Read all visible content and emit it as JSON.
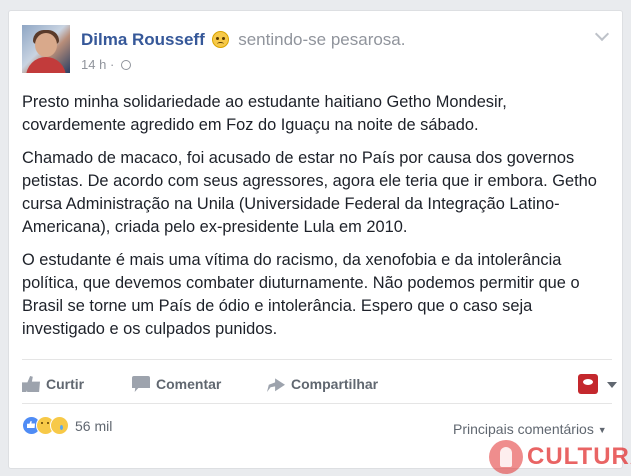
{
  "header": {
    "author": "Dilma Rousseff",
    "feeling": "sentindo-se pesarosa.",
    "timestamp": "14 h",
    "separator": "·"
  },
  "post": {
    "paragraphs": [
      "Presto minha solidariedade ao estudante haitiano Getho Mondesir, covardemente agredido em Foz do Iguaçu na noite de sábado.",
      "Chamado de macaco, foi acusado de estar no País por causa dos governos petistas. De acordo com seus agressores, agora ele teria que ir embora. Getho cursa Administração na Unila (Universidade Federal da Integração Latino-Americana), criada pelo ex-presidente Lula em 2010.",
      "O estudante é mais uma vítima do racismo, da xenofobia e da intolerância política, que devemos combater diuturnamente. Não podemos permitir que o Brasil se torne um País de ódio e intolerância. Espero que o caso seja investigado e os culpados punidos."
    ]
  },
  "actions": {
    "like": "Curtir",
    "comment": "Comentar",
    "share": "Compartilhar"
  },
  "footer": {
    "reaction_count": "56 mil",
    "sort_label": "Principais comentários",
    "sort_caret": "▼"
  },
  "watermark": {
    "text": "CULTURA"
  },
  "colors": {
    "name": "#365899",
    "text": "#1d2129",
    "muted": "#90949c",
    "brand_red": "#c4282d"
  },
  "icons": {
    "avatar": "avatar",
    "feeling": "sad-face-icon",
    "privacy": "globe-icon",
    "menu": "chevron-down-icon",
    "like": "thumbs-up-icon",
    "comment": "comment-bubble-icon",
    "share": "share-arrow-icon"
  }
}
